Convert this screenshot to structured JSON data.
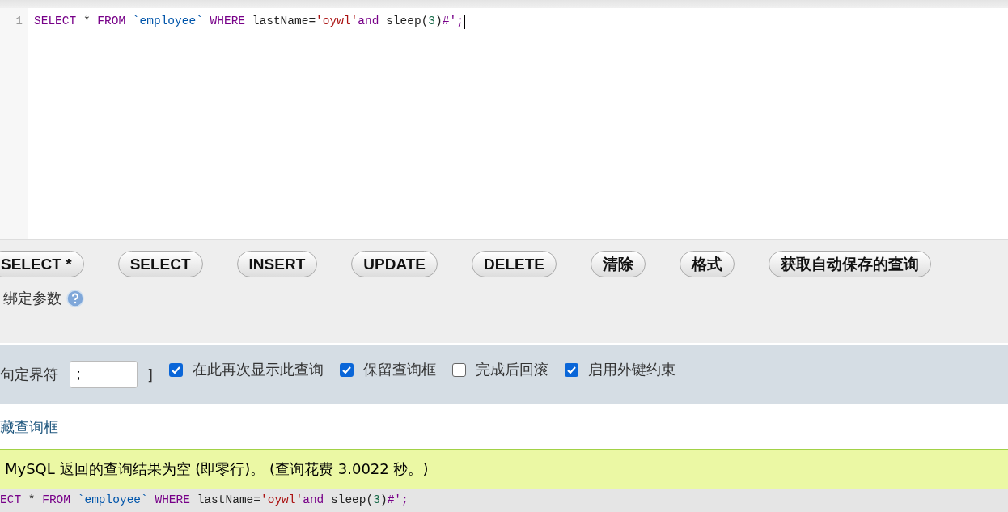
{
  "editor": {
    "line_number": "1",
    "tokens": [
      {
        "kind": "keyword",
        "text": "SELECT"
      },
      {
        "kind": "plain",
        "text": " * "
      },
      {
        "kind": "keyword",
        "text": "FROM"
      },
      {
        "kind": "identifier",
        "text": " `employee` "
      },
      {
        "kind": "keyword",
        "text": "WHERE"
      },
      {
        "kind": "plain",
        "text": " lastName="
      },
      {
        "kind": "string",
        "text": "'oywl'"
      },
      {
        "kind": "keyword",
        "text": "and"
      },
      {
        "kind": "plain",
        "text": " sleep("
      },
      {
        "kind": "number",
        "text": "3"
      },
      {
        "kind": "plain",
        "text": ")"
      },
      {
        "kind": "keyword",
        "text": "#';"
      }
    ]
  },
  "buttons": [
    "SELECT *",
    "SELECT",
    "INSERT",
    "UPDATE",
    "DELETE",
    "清除",
    "格式",
    "获取自动保存的查询"
  ],
  "bind_parameters": {
    "label": "绑定参数"
  },
  "options": {
    "delimiter_label": "句定界符",
    "delimiter_value": ";",
    "bracket": "]",
    "checkboxes": [
      {
        "label": "在此再次显示此查询",
        "checked": true
      },
      {
        "label": "保留查询框",
        "checked": true
      },
      {
        "label": "完成后回滚",
        "checked": false
      },
      {
        "label": "启用外键约束",
        "checked": true
      }
    ]
  },
  "hide_query_link": "藏查询框",
  "result_message": "MySQL 返回的查询结果为空 (即零行)。 (查询花费 3.0022 秒。)",
  "query_echo": {
    "tokens": [
      {
        "kind": "keyword",
        "text": "ECT"
      },
      {
        "kind": "plain",
        "text": " * "
      },
      {
        "kind": "keyword",
        "text": "FROM"
      },
      {
        "kind": "identifier",
        "text": " `employee` "
      },
      {
        "kind": "keyword",
        "text": "WHERE"
      },
      {
        "kind": "plain",
        "text": " lastName="
      },
      {
        "kind": "string",
        "text": "'oywl'"
      },
      {
        "kind": "keyword",
        "text": "and"
      },
      {
        "kind": "plain",
        "text": " sleep("
      },
      {
        "kind": "number",
        "text": "3"
      },
      {
        "kind": "plain",
        "text": ")"
      },
      {
        "kind": "keyword",
        "text": "#';"
      }
    ]
  }
}
